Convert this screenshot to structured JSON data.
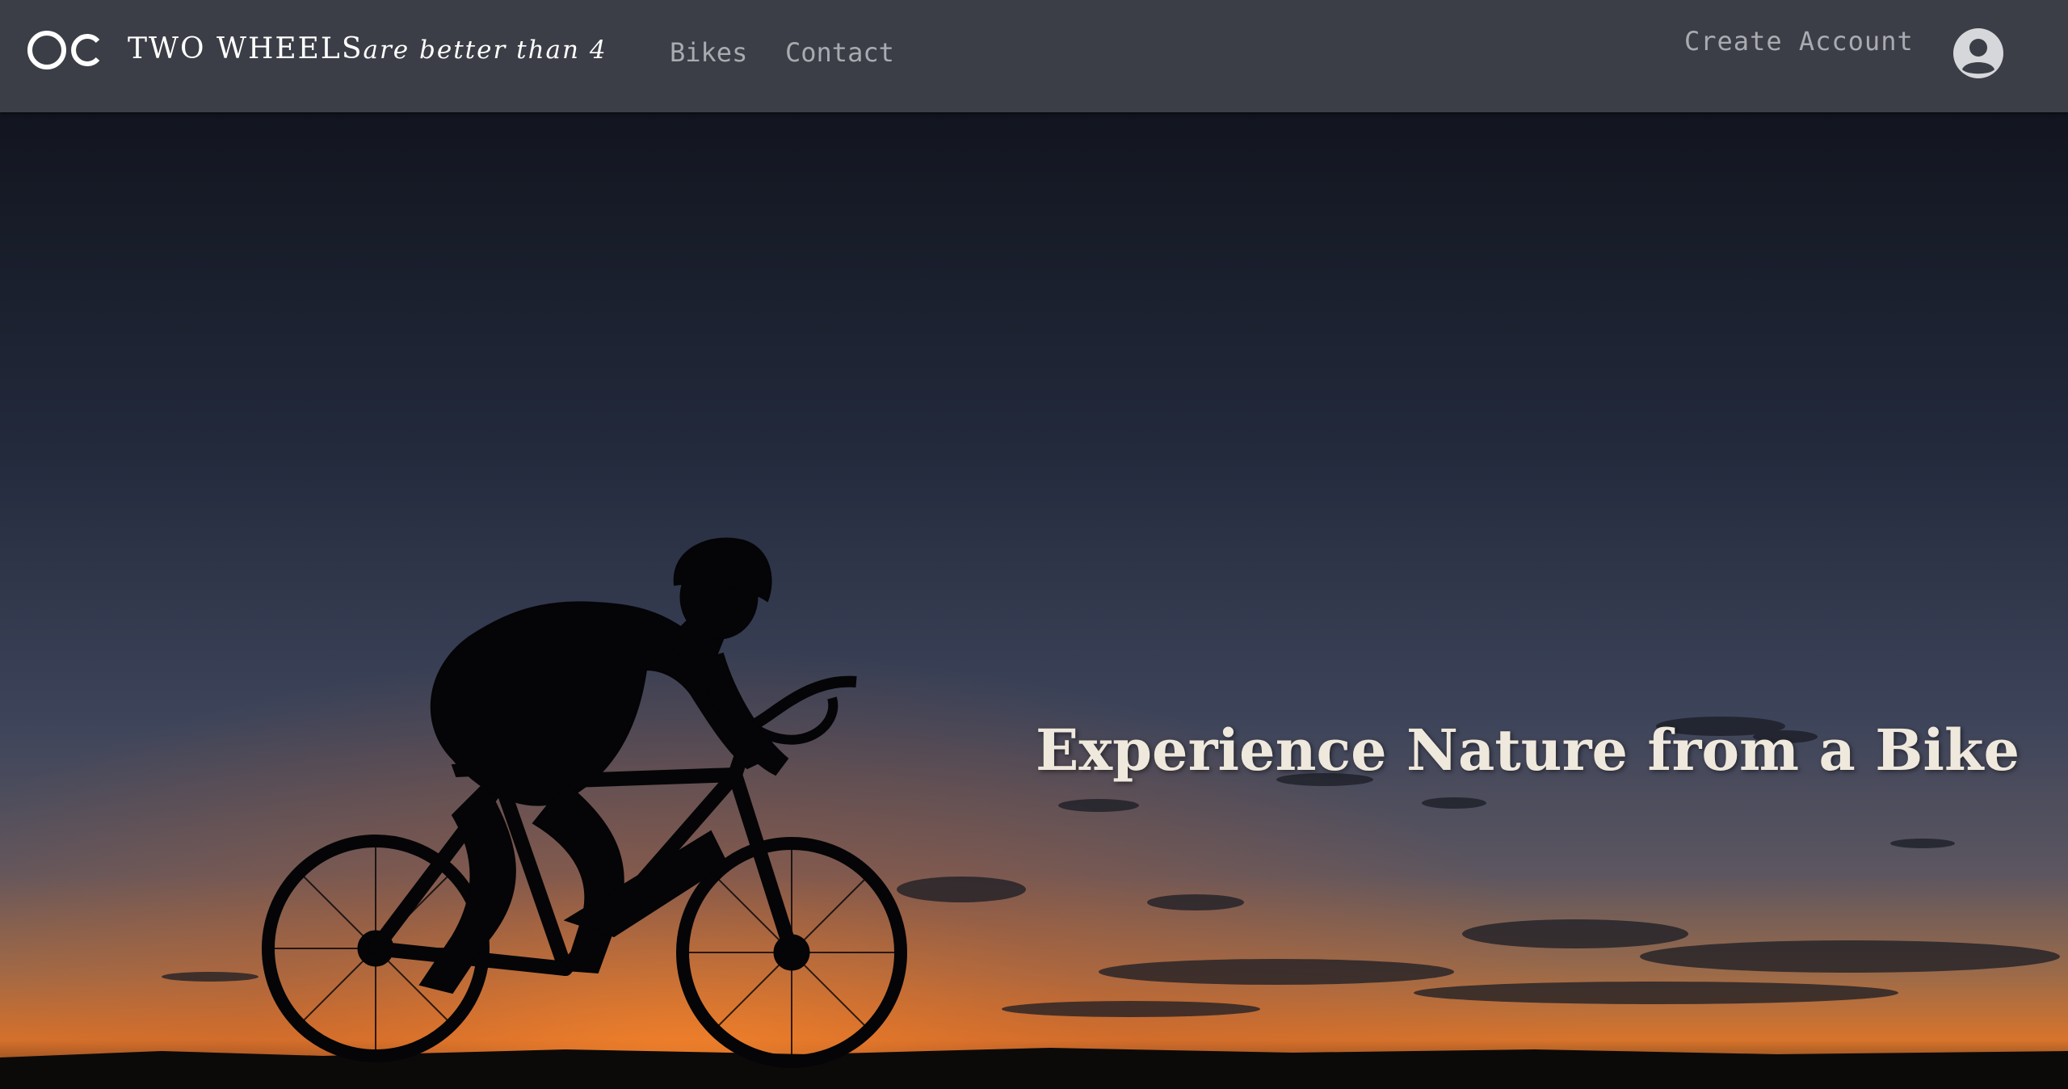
{
  "header": {
    "logo_icon": "cc-logo-icon",
    "brand_name": "TWO WHEELS",
    "brand_tagline": "are better than 4",
    "nav": [
      {
        "label": "Bikes"
      },
      {
        "label": "Contact"
      }
    ],
    "create_account_label": "Create Account",
    "avatar_icon": "user-circle-icon"
  },
  "hero": {
    "title": "Experience Nature from a Bike",
    "image": "cyclist-silhouette-sunset",
    "colors": {
      "sky_top": "#141a26",
      "sky_mid": "#3a4258",
      "horizon": "#e07a2e",
      "title_text": "#efe8dc"
    }
  },
  "colors": {
    "navbar_bg": "#3b3e46",
    "nav_link": "#a9abb0",
    "brand_text": "#ffffff"
  }
}
